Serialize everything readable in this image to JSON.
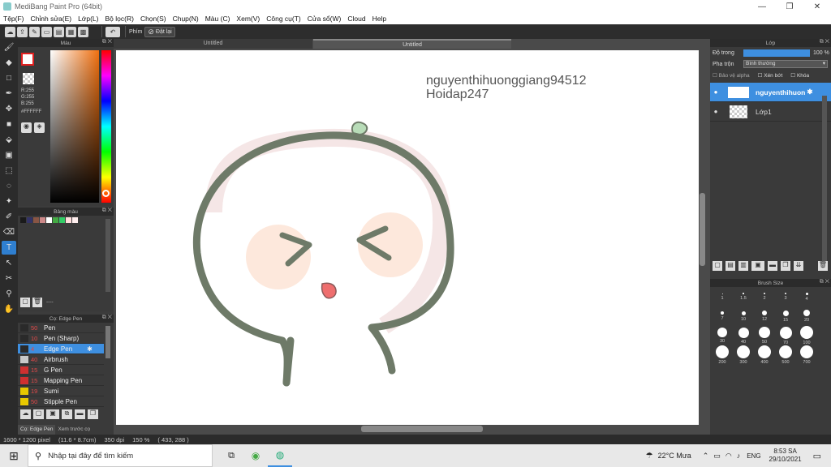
{
  "window": {
    "title": "MediBang Paint Pro (64bit)",
    "minimize": "—",
    "restore": "❐",
    "close": "✕"
  },
  "menu": [
    "Tệp(F)",
    "Chỉnh sửa(E)",
    "Lớp(L)",
    "Bộ lọc(R)",
    "Chọn(S)",
    "Chụp(N)",
    "Màu (C)",
    "Xem(V)",
    "Công cụ(T)",
    "Cửa sổ(W)",
    "Cloud",
    "Help"
  ],
  "toolbar": {
    "key_label": "Phím",
    "reset_label": "Đặt lại"
  },
  "tabs": [
    "Untitled",
    "Untitled"
  ],
  "color_panel": {
    "title": "Màu",
    "r": "R:255",
    "g": "G:255",
    "b": "B:255",
    "hex": "#FFFFFF"
  },
  "palette_panel": {
    "title": "Bảng màu",
    "value": "----"
  },
  "palette_colors": [
    "#1a1a1a",
    "#333366",
    "#885544",
    "#cc8888",
    "#ffffff",
    "#44aa44",
    "#33cc66",
    "#ffdddd",
    "#ffeeee"
  ],
  "brush_panel": {
    "title": "Cọ: Edge Pen",
    "items": [
      {
        "size": "50",
        "name": "Pen",
        "color": "#2a2a2a"
      },
      {
        "size": "10",
        "name": "Pen (Sharp)",
        "color": "#2a2a2a"
      },
      {
        "size": "4",
        "name": "Edge Pen",
        "color": "#2a2a2a"
      },
      {
        "size": "40",
        "name": "Airbrush",
        "color": "#c8c8c8"
      },
      {
        "size": "15",
        "name": "G Pen",
        "color": "#d03030"
      },
      {
        "size": "15",
        "name": "Mapping Pen",
        "color": "#d03030"
      },
      {
        "size": "19",
        "name": "Sumi",
        "color": "#e8c800"
      },
      {
        "size": "50",
        "name": "Stipple Pen",
        "color": "#e8c800"
      }
    ],
    "tab_brush": "Cọ: Edge Pen",
    "tab_preview": "Xem trước cọ"
  },
  "layer_panel": {
    "title": "Lớp",
    "opacity_label": "Độ trong",
    "opacity_value": "100 %",
    "opacity_fraction": 1.0,
    "blend_label": "Pha trộn",
    "blend_value": "Bình thường",
    "protect_alpha": "Bảo vệ alpha",
    "clipping": "Xén bớt",
    "lock": "Khóa",
    "layers": [
      {
        "name": "nguyenthihuon"
      },
      {
        "name": "Lớp1"
      }
    ]
  },
  "brush_size_panel": {
    "title": "Brush Size",
    "sizes": [
      "1",
      "1.5",
      "2",
      "3",
      "4",
      "7",
      "10",
      "12",
      "15",
      "20",
      "30",
      "40",
      "50",
      "70",
      "100",
      "200",
      "300",
      "400",
      "500",
      "700"
    ]
  },
  "canvas_text": {
    "line1": "nguyenthihuonggiang94512",
    "line2": "Hoidap247"
  },
  "status": {
    "pixels": "1600 * 1200 pixel",
    "physical": "(11.6 * 8.7cm)",
    "dpi": "350 dpi",
    "zoom": "150 %",
    "coords": "( 433, 288 )"
  },
  "taskbar": {
    "search_placeholder": "Nhập tại đây để tìm kiếm",
    "weather": "22°C Mưa",
    "lang": "ENG",
    "time": "8:53 SA",
    "date": "29/10/2021"
  },
  "colors": {
    "accent": "#3e8fe0",
    "line": "#6e7a68",
    "blush": "#fde8dc"
  }
}
